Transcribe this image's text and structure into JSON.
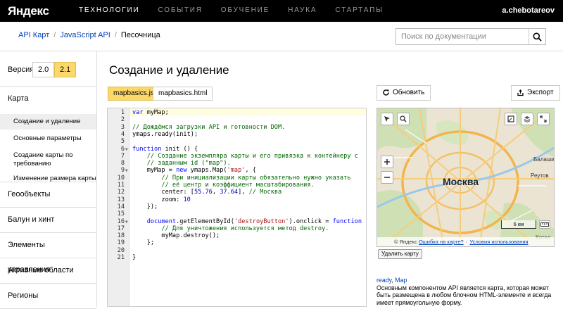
{
  "topbar": {
    "logo": "Яндекс",
    "nav": [
      "ТЕХНОЛОГИИ",
      "СОБЫТИЯ",
      "ОБУЧЕНИЕ",
      "НАУКА",
      "СТАРТАПЫ"
    ],
    "user": "a.chebotareov"
  },
  "breadcrumb": {
    "items": [
      "API Карт",
      "JavaScript API"
    ],
    "current": "Песочница"
  },
  "search": {
    "placeholder": "Поиск по документации",
    "icon": "search-icon"
  },
  "sidebar": {
    "version_label": "Версия:",
    "versions": [
      "2.0",
      "2.1"
    ],
    "selected_version": "2.1",
    "sections": [
      {
        "title": "Карта",
        "items": [
          "Создание и удаление",
          "Основные параметры",
          "Создание карты по требованию",
          "Изменение размера карты"
        ]
      },
      {
        "title": "Геообъекты"
      },
      {
        "title": "Балун и хинт"
      },
      {
        "title": "Элементы управления"
      },
      {
        "title": "Активные области"
      },
      {
        "title": "Регионы"
      }
    ]
  },
  "main": {
    "title": "Создание и удаление",
    "file_tabs": [
      "mapbasics.js",
      "mapbasics.html"
    ],
    "refresh_label": "Обновить",
    "export_label": "Экспорт",
    "delete_label": "Удалить карту"
  },
  "code": [
    "var myMap;",
    "",
    "// Дождёмся загрузки API и готовности DOM.",
    "ymaps.ready(init);",
    "",
    "function init () {",
    "    // Создание экземпляра карты и его привязка к контейнеру с",
    "    // заданным id (\"map\").",
    "    myMap = new ymaps.Map('map', {",
    "        // При инициализации карты обязательно нужно указать",
    "        // её центр и коэффициент масштабирования.",
    "        center: [55.76, 37.64], // Москва",
    "        zoom: 10",
    "    });",
    "",
    "    document.getElementById('destroyButton').onclick = function () {",
    "        // Для уничтожения используется метод destroy.",
    "        myMap.destroy();",
    "    };",
    "",
    "}"
  ],
  "map": {
    "city": "Москва",
    "labels": [
      "Балаши",
      "Реутов",
      "Котел"
    ],
    "scale": "6 км",
    "copyright": "© Яндекс",
    "error_link": "Ошибка на карте?",
    "terms_link": "Условия использования"
  },
  "doc": {
    "link1": "ready",
    "link2": "Map",
    "text": "Основным компонентом API является карта, которая может быть размещена в любом блочном HTML-элементе и всегда имеет прямоугольную форму."
  }
}
